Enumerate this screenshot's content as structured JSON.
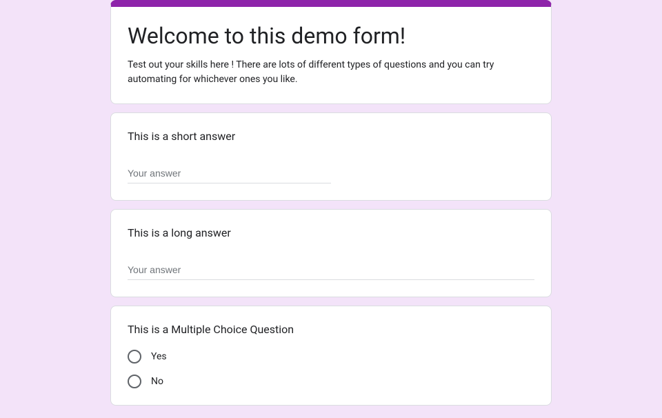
{
  "header": {
    "title": "Welcome to this demo form!",
    "description": "Test out your skills here ! There are lots of different types of questions and you can try automating for whichever ones you like."
  },
  "questions": {
    "short_answer": {
      "title": "This is a short answer",
      "placeholder": "Your answer"
    },
    "long_answer": {
      "title": "This is a long answer",
      "placeholder": "Your answer"
    },
    "multiple_choice": {
      "title": "This is a Multiple Choice Question",
      "options": [
        "Yes",
        "No"
      ]
    }
  }
}
